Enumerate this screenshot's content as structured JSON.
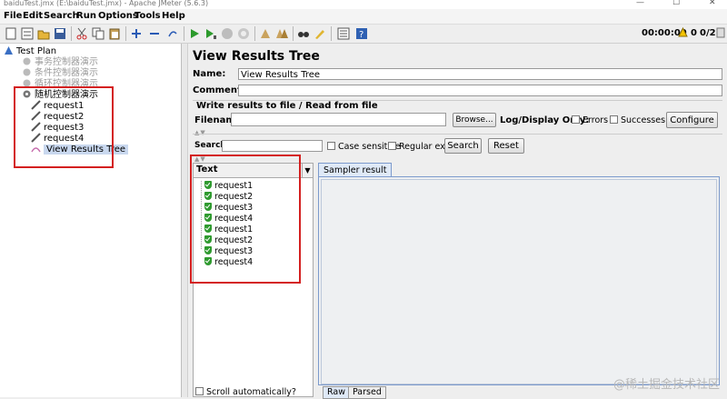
{
  "window": {
    "title": "baiduTest.jmx (E:\\baiduTest.jmx) - Apache JMeter (5.6.3)",
    "controls": [
      "—",
      "☐",
      "✕"
    ]
  },
  "menu": [
    "File",
    "Edit",
    "Search",
    "Run",
    "Options",
    "Tools",
    "Help"
  ],
  "toolbar_status": {
    "timer": "00:00:00",
    "warnings": "0",
    "threads": "0/2"
  },
  "tree": {
    "root": "Test Plan",
    "controllers": [
      "事务控制器演示",
      "条件控制器演示",
      "循环控制器演示",
      "随机控制器演示"
    ],
    "random_children": [
      "request1",
      "request2",
      "request3",
      "request4",
      "View Results Tree"
    ]
  },
  "panel": {
    "title": "View Results Tree",
    "name_label": "Name:",
    "name_value": "View Results Tree",
    "comments_label": "Comments:",
    "comments_value": "",
    "write_results_label": "Write results to file / Read from file",
    "filename_label": "Filename",
    "filename_value": "",
    "browse": "Browse...",
    "logdisplay_label": "Log/Display Only:",
    "errors": "Errors",
    "successes": "Successes",
    "configure": "Configure",
    "search_label": "Search:",
    "search_value": "",
    "case_sensitive": "Case sensitive",
    "regular_exp": "Regular exp.",
    "search_btn": "Search",
    "reset_btn": "Reset",
    "renderer": "Text",
    "results": [
      "request1",
      "request2",
      "request3",
      "request4",
      "request1",
      "request2",
      "request3",
      "request4"
    ],
    "scroll_auto": "Scroll automatically?",
    "sampler_tab": "Sampler result",
    "raw_tab": "Raw",
    "parsed_tab": "Parsed"
  },
  "watermark": "@稀土掘金技术社区"
}
